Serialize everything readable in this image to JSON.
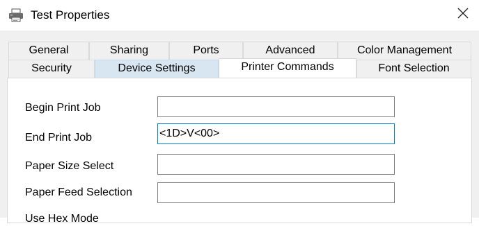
{
  "window": {
    "title": "Test Properties",
    "close_icon": "close-icon",
    "app_icon": "printer-icon"
  },
  "tabs": {
    "row_back": [
      "General",
      "Sharing",
      "Ports",
      "Advanced",
      "Color Management"
    ],
    "row_front": [
      "Security",
      "Device Settings",
      "Printer Commands",
      "Font Selection"
    ],
    "active": "Printer Commands",
    "hovered": "Device Settings"
  },
  "fields": [
    {
      "label": "Begin Print Job",
      "value": ""
    },
    {
      "label": "End Print Job",
      "value": "<1D>V<00>"
    },
    {
      "label": "Paper Size Select",
      "value": ""
    },
    {
      "label": "Paper Feed Selection",
      "value": ""
    }
  ],
  "cut_off_label": "Use Hex Mode",
  "colors": {
    "tab_hover": "#d8e6f2",
    "focus_border": "#0078d7",
    "dialog_bg": "#f0f0f0"
  }
}
